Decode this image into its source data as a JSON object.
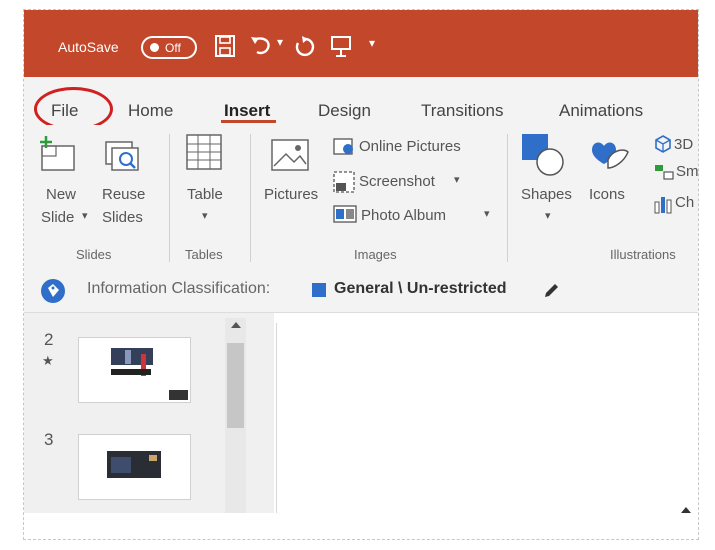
{
  "quick_access": {
    "autosave_label": "AutoSave",
    "autosave_state": "Off",
    "icons": [
      "save-icon",
      "undo-icon",
      "redo-icon",
      "present-icon",
      "customize-icon"
    ]
  },
  "tabs": [
    "File",
    "Home",
    "Insert",
    "Design",
    "Transitions",
    "Animations"
  ],
  "active_tab": "Insert",
  "ribbon": {
    "slides": {
      "new_line1": "New",
      "new_line2": "Slide",
      "reuse_line1": "Reuse",
      "reuse_line2": "Slides",
      "group": "Slides"
    },
    "tables": {
      "table": "Table",
      "group": "Tables"
    },
    "images": {
      "pictures": "Pictures",
      "online": "Online Pictures",
      "screenshot": "Screenshot",
      "album": "Photo Album",
      "group": "Images"
    },
    "illustrations": {
      "shapes": "Shapes",
      "icons": "Icons",
      "models": "3D",
      "smartart": "Sm",
      "chart": "Ch",
      "group": "Illustrations"
    }
  },
  "info_bar": {
    "label": "Information Classification:",
    "value": "General \\ Un-restricted",
    "accent": "#2f6fc9"
  },
  "slides": [
    {
      "number": "2",
      "marker": "★"
    },
    {
      "number": "3",
      "marker": ""
    }
  ],
  "colors": {
    "titlebar": "#c3472a",
    "highlight_circle": "#d02020"
  }
}
